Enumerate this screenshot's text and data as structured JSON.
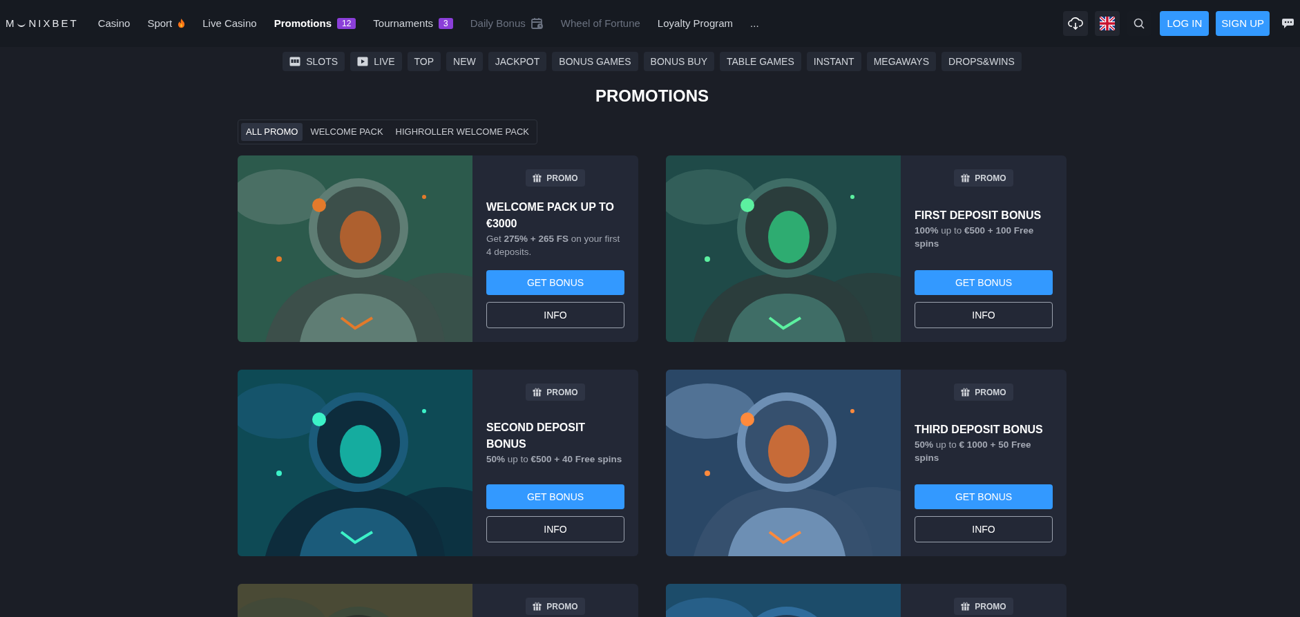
{
  "logo": {
    "left": "M",
    "right": "NIXBET"
  },
  "nav": [
    {
      "label": "Casino",
      "selected": false,
      "dimmed": false,
      "kind": "plain"
    },
    {
      "label": "Sport",
      "selected": false,
      "dimmed": false,
      "kind": "hot"
    },
    {
      "label": "Live Casino",
      "selected": false,
      "dimmed": false,
      "kind": "plain"
    },
    {
      "label": "Promotions",
      "selected": true,
      "dimmed": false,
      "kind": "plain",
      "badge": "12"
    },
    {
      "label": "Tournaments",
      "selected": false,
      "dimmed": false,
      "kind": "plain",
      "badge": "3"
    },
    {
      "label": "Daily Bonus",
      "selected": false,
      "dimmed": true,
      "kind": "dated"
    },
    {
      "label": "Wheel of Fortune",
      "selected": false,
      "dimmed": true,
      "kind": "plain"
    },
    {
      "label": "Loyalty Program",
      "selected": false,
      "dimmed": false,
      "kind": "plain"
    },
    {
      "label": "...",
      "selected": false,
      "dimmed": false,
      "kind": "plain"
    }
  ],
  "header_buttons": {
    "login": "LOG IN",
    "signup": "SIGN UP"
  },
  "categories": [
    {
      "label": "SLOTS",
      "kind": "slots"
    },
    {
      "label": "LIVE",
      "kind": "live"
    },
    {
      "label": "TOP",
      "kind": "plain"
    },
    {
      "label": "NEW",
      "kind": "plain"
    },
    {
      "label": "JACKPOT",
      "kind": "plain"
    },
    {
      "label": "BONUS GAMES",
      "kind": "plain"
    },
    {
      "label": "BONUS BUY",
      "kind": "plain"
    },
    {
      "label": "TABLE GAMES",
      "kind": "plain"
    },
    {
      "label": "INSTANT",
      "kind": "plain"
    },
    {
      "label": "MEGAWAYS",
      "kind": "plain"
    },
    {
      "label": "DROPS&WINS",
      "kind": "plain"
    }
  ],
  "page_title": "PROMOTIONS",
  "filter_tabs": [
    {
      "label": "ALL PROMO",
      "selected": true
    },
    {
      "label": "WELCOME PACK",
      "selected": false
    },
    {
      "label": "HIGHROLLER WELCOME PACK",
      "selected": false
    }
  ],
  "cards": [
    {
      "badge": "PROMO",
      "title": "WELCOME PACK UP TO €3000",
      "description": "Get **275% + 265 FS** on your first 4 deposits.",
      "primary": "GET BONUS",
      "secondary": "INFO"
    },
    {
      "badge": "PROMO",
      "title": "FIRST DEPOSIT BONUS",
      "description": "**100%** up to **€500 + 100 Free spins**",
      "primary": "GET BONUS",
      "secondary": "INFO"
    },
    {
      "badge": "PROMO",
      "title": "SECOND DEPOSIT BONUS",
      "description": "**50%** up to **€500 + 40 Free spins**",
      "primary": "GET BONUS",
      "secondary": "INFO"
    },
    {
      "badge": "PROMO",
      "title": "THIRD DEPOSIT BONUS",
      "description": "**50%** up to **€ 1000 + 50 Free spins**",
      "primary": "GET BONUS",
      "secondary": "INFO"
    },
    {
      "badge": "PROMO"
    },
    {
      "badge": "PROMO"
    }
  ]
}
